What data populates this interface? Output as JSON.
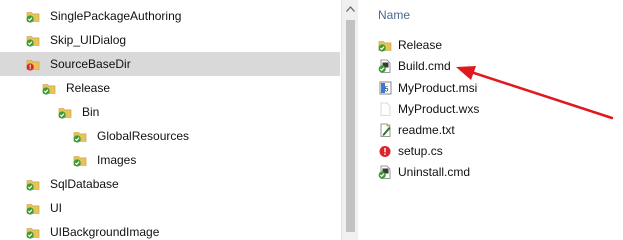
{
  "tree": {
    "items": [
      {
        "label": "SinglePackageAuthoring",
        "icon": "folder-check-icon",
        "indent": 0
      },
      {
        "label": "Skip_UIDialog",
        "icon": "folder-check-icon",
        "indent": 0
      },
      {
        "label": "SourceBaseDir",
        "icon": "folder-error-icon",
        "indent": 0,
        "selected": true
      },
      {
        "label": "Release",
        "icon": "folder-check-icon",
        "indent": 1
      },
      {
        "label": "Bin",
        "icon": "folder-check-icon",
        "indent": 2
      },
      {
        "label": "GlobalResources",
        "icon": "folder-check-icon",
        "indent": 3
      },
      {
        "label": "Images",
        "icon": "folder-check-icon",
        "indent": 3
      },
      {
        "label": "SqlDatabase",
        "icon": "folder-check-icon",
        "indent": 0
      },
      {
        "label": "UI",
        "icon": "folder-check-icon",
        "indent": 0
      },
      {
        "label": "UIBackgroundImage",
        "icon": "folder-check-icon",
        "indent": 0
      }
    ]
  },
  "files": {
    "column_name": "Name",
    "items": [
      {
        "label": "Release",
        "icon": "folder-check-icon"
      },
      {
        "label": "Build.cmd",
        "icon": "cmd-file-check-icon"
      },
      {
        "label": "MyProduct.msi",
        "icon": "msi-file-icon"
      },
      {
        "label": "MyProduct.wxs",
        "icon": "blank-file-icon"
      },
      {
        "label": "readme.txt",
        "icon": "txt-file-edit-icon"
      },
      {
        "label": "setup.cs",
        "icon": "file-error-icon"
      },
      {
        "label": "Uninstall.cmd",
        "icon": "cmd-file-check-icon"
      }
    ]
  },
  "colors": {
    "folder": "#e8c25a",
    "check": "#3d9b35",
    "error": "#d8262b",
    "arrow": "#e0191f",
    "selected_row": "#d9d9d9"
  }
}
